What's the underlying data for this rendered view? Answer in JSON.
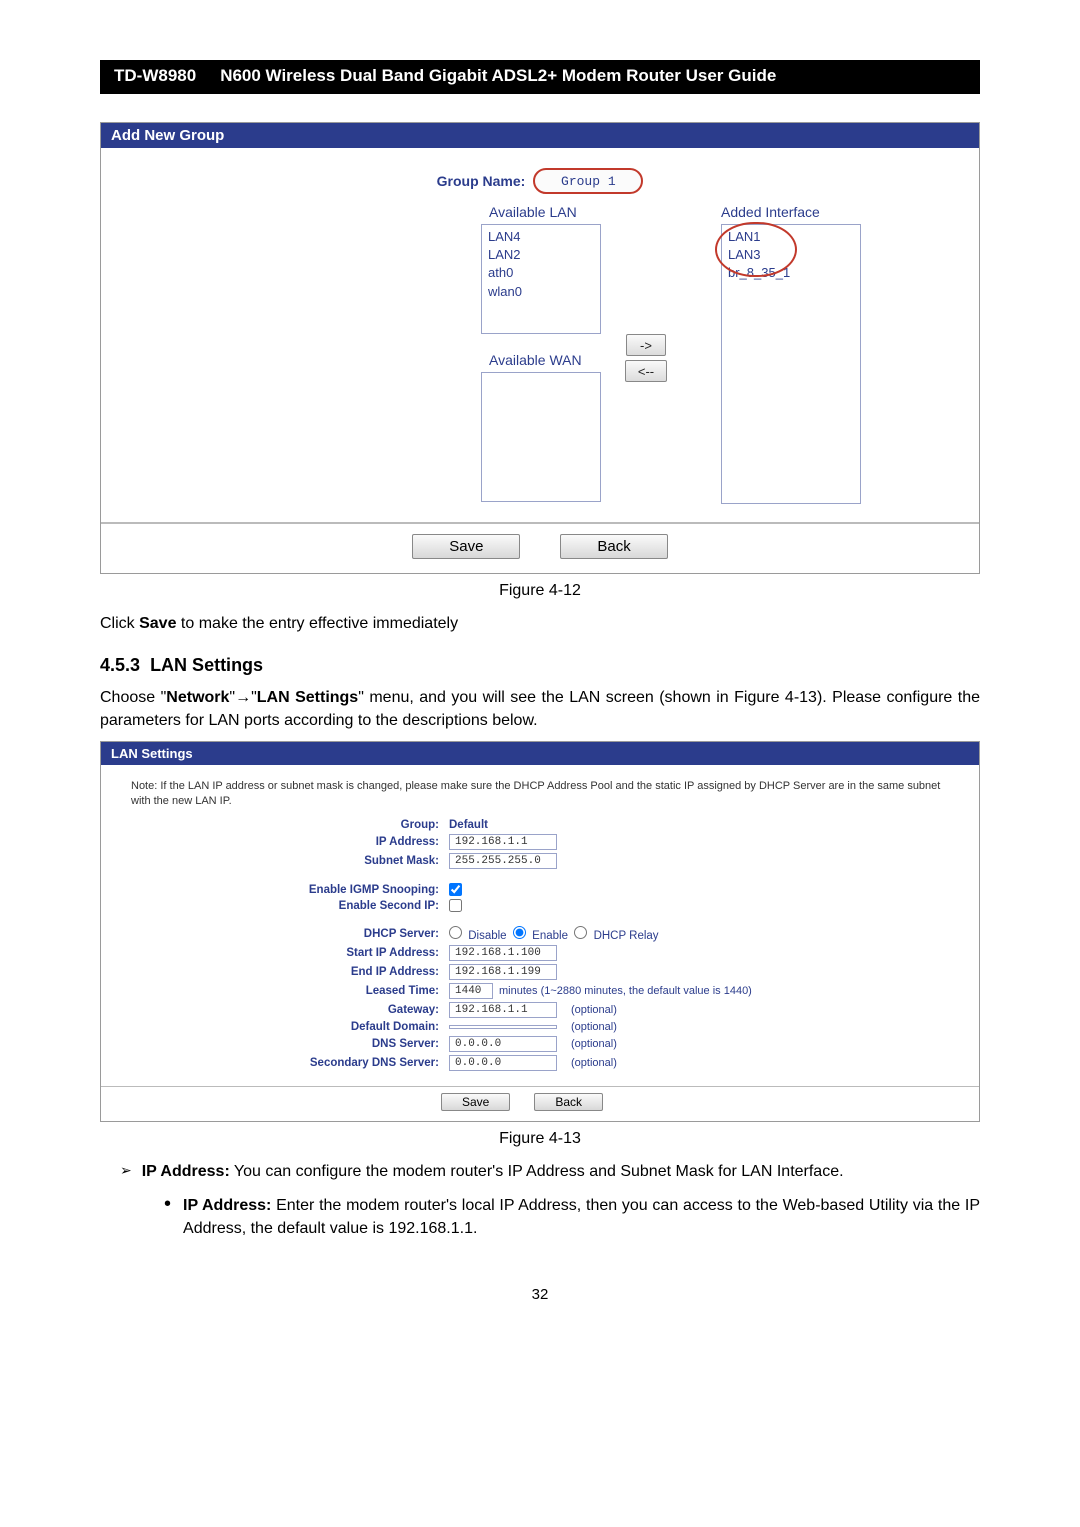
{
  "header": {
    "model": "TD-W8980",
    "title": "N600 Wireless Dual Band Gigabit ADSL2+ Modem Router User Guide"
  },
  "fig412": {
    "panel_title": "Add New Group",
    "group_name_label": "Group Name:",
    "group_name_value": "Group 1",
    "available_lan_label": "Available LAN",
    "added_interface_label": "Added Interface",
    "available_wan_label": "Available WAN",
    "avail_lan": {
      "a": "LAN4",
      "b": "LAN2",
      "c": "ath0",
      "d": "wlan0"
    },
    "added_if": {
      "a": "LAN1",
      "b": "LAN3",
      "c": "br_8_35_1"
    },
    "btn_right": "->",
    "btn_left": "<--",
    "save": "Save",
    "back": "Back",
    "caption": "Figure 4-12"
  },
  "text1": {
    "p": "Click ",
    "save": "Save",
    "rest": " to make the entry effective immediately"
  },
  "section": {
    "num": "4.5.3",
    "title": "LAN Settings"
  },
  "text2": {
    "p": "Choose \"Network\"→\"LAN Settings\" menu, and you will see the LAN screen (shown in Figure 4-13). Please configure the parameters for LAN ports according to the descriptions below."
  },
  "fig413": {
    "panel_title": "LAN Settings",
    "note": "Note: If the LAN IP address or subnet mask is changed, please make sure the DHCP Address Pool and the static IP assigned by DHCP Server are in the same subnet with the new LAN IP.",
    "group_label": "Group:",
    "group_value": "Default",
    "ip_label": "IP Address:",
    "ip_value": "192.168.1.1",
    "mask_label": "Subnet Mask:",
    "mask_value": "255.255.255.0",
    "igmp_label": "Enable IGMP Snooping:",
    "second_ip_label": "Enable Second IP:",
    "dhcp_label": "DHCP Server:",
    "dhcp_disable": "Disable",
    "dhcp_enable": "Enable",
    "dhcp_relay": "DHCP Relay",
    "start_ip_label": "Start IP Address:",
    "start_ip_value": "192.168.1.100",
    "end_ip_label": "End IP Address:",
    "end_ip_value": "192.168.1.199",
    "leased_label": "Leased Time:",
    "leased_value": "1440",
    "leased_note": "minutes (1~2880 minutes, the default value is 1440)",
    "gateway_label": "Gateway:",
    "gateway_value": "192.168.1.1",
    "domain_label": "Default Domain:",
    "domain_value": "",
    "dns_label": "DNS Server:",
    "dns_value": "0.0.0.0",
    "sdns_label": "Secondary DNS Server:",
    "sdns_value": "0.0.0.0",
    "optional": "(optional)",
    "save": "Save",
    "back": "Back",
    "caption": "Figure 4-13"
  },
  "bullets": {
    "b1_pre": "IP Address:",
    "b1_text": " You can configure the modem router's IP Address and Subnet Mask for LAN Interface.",
    "s1_pre": "IP Address:",
    "s1_text": " Enter the modem router's local IP Address, then you can access to the Web-based Utility via the IP Address, the default value is 192.168.1.1."
  },
  "pageno": "32"
}
